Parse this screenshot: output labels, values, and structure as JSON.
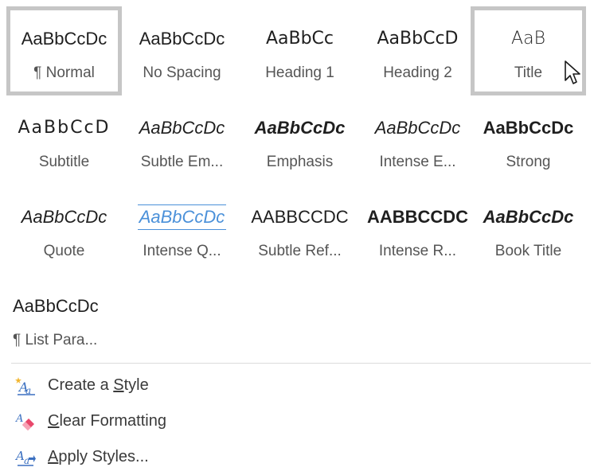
{
  "styles": [
    {
      "id": "normal",
      "preview": "AaBbCcDc",
      "label": "¶ Normal",
      "selected": true
    },
    {
      "id": "nospacing",
      "preview": "AaBbCcDc",
      "label": "No Spacing",
      "selected": false
    },
    {
      "id": "h1",
      "preview": "AaBbCc",
      "label": "Heading 1",
      "selected": false
    },
    {
      "id": "h2",
      "preview": "AaBbCcD",
      "label": "Heading 2",
      "selected": false
    },
    {
      "id": "title",
      "preview": "AaB",
      "label": "Title",
      "selected": true
    },
    {
      "id": "subtitle",
      "preview": "AaBbCcD",
      "label": "Subtitle",
      "selected": false
    },
    {
      "id": "subtleem",
      "preview": "AaBbCcDc",
      "label": "Subtle Em...",
      "selected": false
    },
    {
      "id": "emphasis",
      "preview": "AaBbCcDc",
      "label": "Emphasis",
      "selected": false
    },
    {
      "id": "intenseem",
      "preview": "AaBbCcDc",
      "label": "Intense E...",
      "selected": false
    },
    {
      "id": "strong",
      "preview": "AaBbCcDc",
      "label": "Strong",
      "selected": false
    },
    {
      "id": "quote",
      "preview": "AaBbCcDc",
      "label": "Quote",
      "selected": false
    },
    {
      "id": "intenseq",
      "preview": "AaBbCcDc",
      "label": "Intense Q...",
      "selected": false
    },
    {
      "id": "subtleref",
      "preview": "AaBbCcDc",
      "label": "Subtle Ref...",
      "selected": false
    },
    {
      "id": "intenser",
      "preview": "AaBbCcDc",
      "label": "Intense R...",
      "selected": false
    },
    {
      "id": "booktitle",
      "preview": "AaBbCcDc",
      "label": "Book Title",
      "selected": false
    },
    {
      "id": "listpara",
      "preview": "AaBbCcDc",
      "label": "¶ List Para...",
      "selected": false
    }
  ],
  "menu": {
    "create_style": {
      "pre": "Create a ",
      "mnemonic": "S",
      "post": "tyle",
      "icon": "create-style-icon"
    },
    "clear_formatting": {
      "pre": "",
      "mnemonic": "C",
      "post": "lear Formatting",
      "icon": "clear-formatting-icon"
    },
    "apply_styles": {
      "pre": "",
      "mnemonic": "A",
      "post": "pply Styles...",
      "icon": "apply-styles-icon"
    }
  },
  "colors": {
    "heading_blue": "#3a86d0",
    "accent_blue": "#4a90d9",
    "selection_border": "#c6c6c6"
  }
}
